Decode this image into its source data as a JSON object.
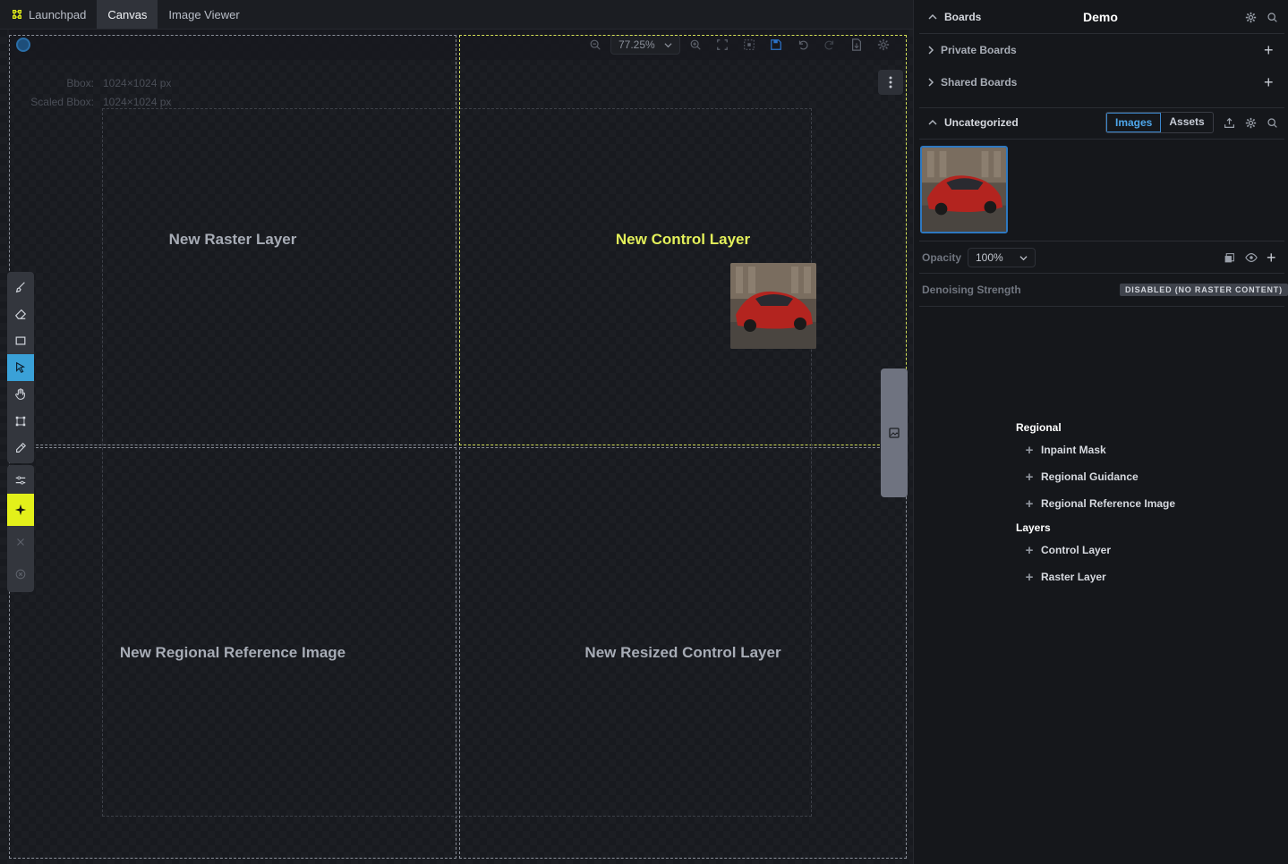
{
  "tabs": [
    {
      "label": "Launchpad",
      "icon": "launchpad-icon",
      "active": false
    },
    {
      "label": "Canvas",
      "active": true
    },
    {
      "label": "Image Viewer",
      "active": false
    }
  ],
  "toolbar": {
    "zoom": "77.25%"
  },
  "bbox": {
    "bbox_label": "Bbox:",
    "bbox_value": "1024×1024 px",
    "scaled_label": "Scaled Bbox:",
    "scaled_value": "1024×1024 px"
  },
  "zones": {
    "raster": "New Raster Layer",
    "control": "New Control Layer",
    "regional_ref": "New Regional Reference Image",
    "resized_control": "New Resized Control Layer"
  },
  "colors": {
    "accent_yellow": "#e3f01a",
    "accent_blue": "#3aa1d8",
    "brand_blue": "#4ea6ea"
  },
  "right_panel": {
    "boards_label": "Boards",
    "board_name": "Demo",
    "private_boards": "Private Boards",
    "shared_boards": "Shared Boards",
    "uncategorized": "Uncategorized",
    "images_tab": "Images",
    "assets_tab": "Assets",
    "opacity_label": "Opacity",
    "opacity_value": "100%",
    "denoise_label": "Denoising Strength",
    "denoise_badge": "DISABLED (NO RASTER CONTENT)"
  },
  "add_menu": {
    "regional_heading": "Regional",
    "regional_items": [
      "Inpaint Mask",
      "Regional Guidance",
      "Regional Reference Image"
    ],
    "layers_heading": "Layers",
    "layer_items": [
      "Control Layer",
      "Raster Layer"
    ]
  }
}
